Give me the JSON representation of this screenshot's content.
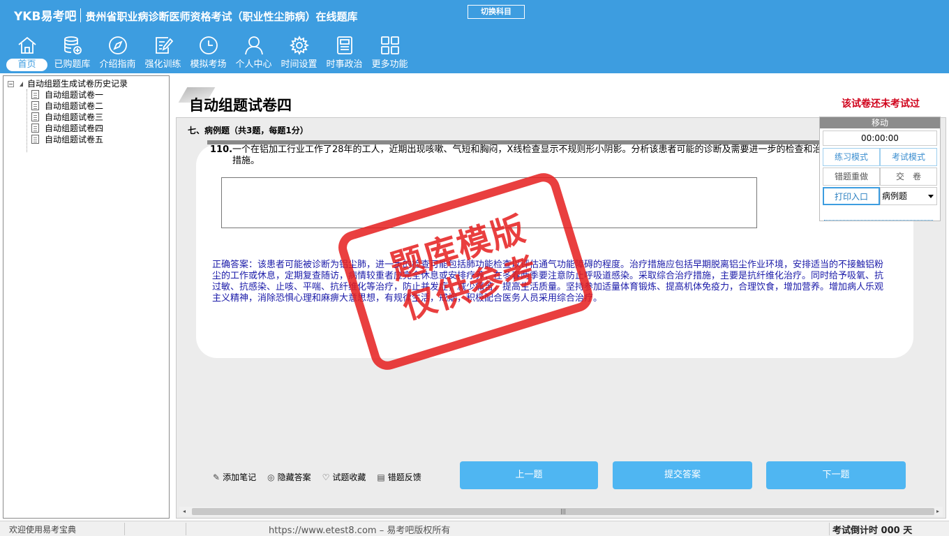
{
  "header": {
    "brand": "YKB易考吧",
    "title": "贵州省职业病诊断医师资格考试（职业性尘肺病）在线题库",
    "switch_subject": "切换科目"
  },
  "nav": [
    {
      "label": "首页",
      "icon": "home-icon"
    },
    {
      "label": "已购题库",
      "icon": "database-icon"
    },
    {
      "label": "介绍指南",
      "icon": "compass-icon"
    },
    {
      "label": "强化训练",
      "icon": "edit-icon"
    },
    {
      "label": "模拟考场",
      "icon": "clock-icon"
    },
    {
      "label": "个人中心",
      "icon": "user-icon"
    },
    {
      "label": "时间设置",
      "icon": "gear-icon"
    },
    {
      "label": "时事政治",
      "icon": "news-icon"
    },
    {
      "label": "更多功能",
      "icon": "grid-icon"
    }
  ],
  "tree": {
    "root": "自动组题生成试卷历史记录",
    "items": [
      "自动组题试卷一",
      "自动组题试卷二",
      "自动组题试卷三",
      "自动组题试卷四",
      "自动组题试卷五"
    ]
  },
  "paper": {
    "title": "自动组题试卷四",
    "status": "该试卷还未考试过"
  },
  "section": {
    "title": "七、病例题（共3题，每题1分）"
  },
  "question": {
    "number": "110.",
    "text": "一个在铝加工行业工作了28年的工人，近期出现咳嗽、气短和胸闷，X线检查显示不规则形小阴影。分析该患者可能的诊断及需要进一步的检查和治疗措施。",
    "answer_value": "",
    "correct_answer": "正确答案：该患者可能被诊断为铝尘肺，进一步的检查可能包括肺功能检查以评估通气功能障碍的程度。治疗措施应包括早期脱离铝尘作业环境，安排适当的不接触铝粉尘的工作或休息，定期复查随访，病情较重者应完全休息或安排疗养，在冬春两季要注意防止呼吸道感染。采取综合治疗措施，主要是抗纤维化治疗。同时给予吸氧、抗过敏、抗感染、止咳、平喘、抗纤维化等治疗，防止并发症，减少痛苦，提高生活质量。坚持参加适量体育锻炼、提高机体免疫力，合理饮食，增加营养。增加病人乐观主义精神，消除恐惧心理和麻痹大意思想，有规律生活，戒烟，积极配合医务人员采用综合治疗。"
  },
  "stamp": {
    "line1": "题库模版",
    "line2": "仅供参考"
  },
  "tools": {
    "add_note": "添加笔记",
    "hide_answer": "隐藏答案",
    "favorite": "试题收藏",
    "feedback": "错题反馈"
  },
  "buttons": {
    "prev": "上一题",
    "submit": "提交答案",
    "next": "下一题"
  },
  "float_panel": {
    "title": "移动",
    "timer": "00:00:00",
    "practice_mode": "练习模式",
    "exam_mode": "考试模式",
    "redo_wrong": "错题重做",
    "hand_in": "交　卷",
    "print": "打印入口",
    "type_select": "病例题"
  },
  "statusbar": {
    "welcome": "欢迎使用易考宝典",
    "copyright": "https://www.etest8.com – 易考吧版权所有",
    "countdown": "考试倒计时 000 天"
  },
  "colors": {
    "header_bg": "#3d9de0",
    "accent_button": "#4fb6f2",
    "status_red": "#d0021b",
    "answer_blue": "#1a1aa8",
    "stamp_red": "#e61e1e"
  }
}
